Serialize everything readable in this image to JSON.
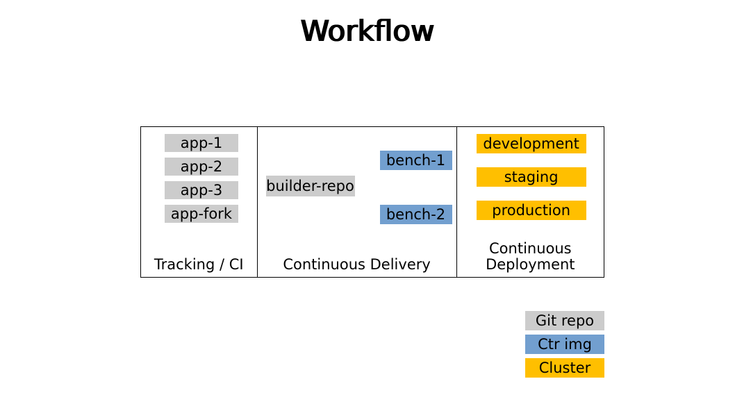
{
  "title": "Workflow",
  "columns": {
    "col1": {
      "label": "Tracking / CI",
      "items": [
        "app-1",
        "app-2",
        "app-3",
        "app-fork"
      ]
    },
    "col2": {
      "label": "Continuous Delivery",
      "builder": "builder-repo",
      "benches": [
        "bench-1",
        "bench-2"
      ]
    },
    "col3": {
      "label_line1": "Continuous",
      "label_line2": "Deployment",
      "envs": [
        "development",
        "staging",
        "production"
      ]
    }
  },
  "legend": {
    "git": "Git repo",
    "ctr": "Ctr img",
    "cluster": "Cluster"
  },
  "colors": {
    "grey": "#cccccc",
    "blue": "#729fcf",
    "orange": "#ffbf00"
  }
}
